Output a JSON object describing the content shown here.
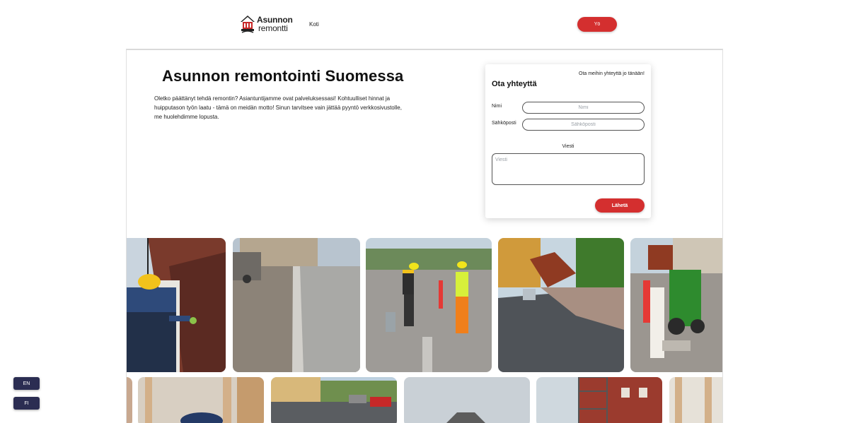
{
  "brand": {
    "name_line1": "Asunnon",
    "name_line2": "remontti"
  },
  "nav": {
    "home": "Koti",
    "header_button": "Yö"
  },
  "hero": {
    "title": "Asunnon remontointi Suomessa",
    "text": "Oletko päättänyt tehdä remontin? Asiantuntijamme ovat palveluksessasi! Kohtuulliset hinnat ja huipputason työn laatu - tämä on meidän motto! Sinun tarvitsee vain jättää pyyntö verkkosivustolle, me huolehdimme lopusta."
  },
  "contact": {
    "tagline": "Ota meihin yhteyttä jo tänään!",
    "title": "Ota yhteyttä",
    "name_label": "Nimi",
    "name_placeholder": "Nimi",
    "email_label": "Sähköposti",
    "email_placeholder": "Sähköposti",
    "message_label": "Viesti",
    "message_placeholder": "Viesti",
    "submit": "Lähetä"
  },
  "gallery": {
    "row1": [
      "roofer-on-ladder",
      "road-curb-construction",
      "workers-at-roadworks",
      "flat-roof-felt",
      "green-excavator"
    ],
    "row2": [
      "wall-insulation-work",
      "street-with-cars",
      "building-under-sky",
      "scaffolding-on-building",
      "wooden-wall-frame"
    ]
  },
  "language": {
    "en": "EN",
    "fi": "FI"
  },
  "colors": {
    "accent": "#d42f2f",
    "lang_button": "#2b2d52"
  }
}
